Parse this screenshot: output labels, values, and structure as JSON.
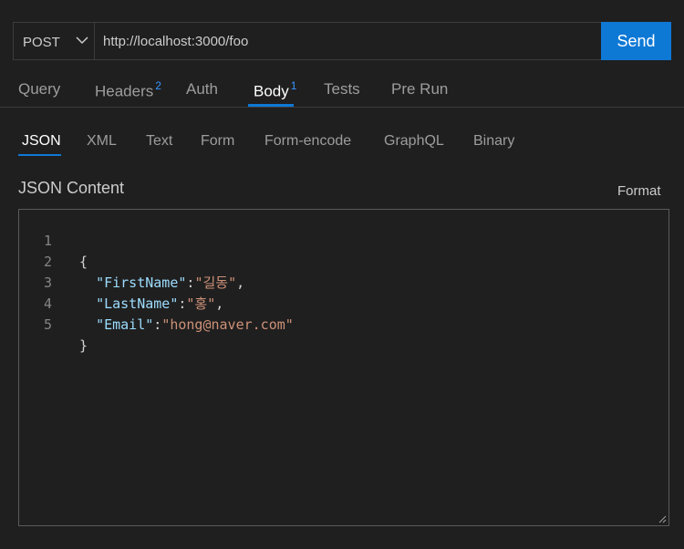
{
  "request": {
    "method": "POST",
    "url": "http://localhost:3000/foo",
    "send_label": "Send"
  },
  "tabs": [
    {
      "label": "Query",
      "badge": ""
    },
    {
      "label": "Headers",
      "badge": "2"
    },
    {
      "label": "Auth",
      "badge": ""
    },
    {
      "label": "Body",
      "badge": "1"
    },
    {
      "label": "Tests",
      "badge": ""
    },
    {
      "label": "Pre Run",
      "badge": ""
    }
  ],
  "body_types": [
    "JSON",
    "XML",
    "Text",
    "Form",
    "Form-encode",
    "GraphQL",
    "Binary"
  ],
  "content": {
    "title": "JSON Content",
    "format_label": "Format",
    "line_numbers": [
      "1",
      "2",
      "3",
      "4",
      "5"
    ],
    "json": {
      "open": "{",
      "close": "}",
      "fields": [
        {
          "key": "\"FirstName\"",
          "value": "\"길동\"",
          "comma": ","
        },
        {
          "key": "\"LastName\"",
          "value": "\"홍\"",
          "comma": ","
        },
        {
          "key": "\"Email\"",
          "value": "\"hong@naver.com\"",
          "comma": ""
        }
      ]
    }
  },
  "icons": {
    "method_dropdown": "chevron-down-icon",
    "resize": "resize-grip-icon"
  },
  "colors": {
    "accent": "#0e78d5",
    "badge": "#3794ff",
    "json_key": "#9cdcfe",
    "json_string": "#ce9178",
    "background": "#1f1f1f"
  }
}
